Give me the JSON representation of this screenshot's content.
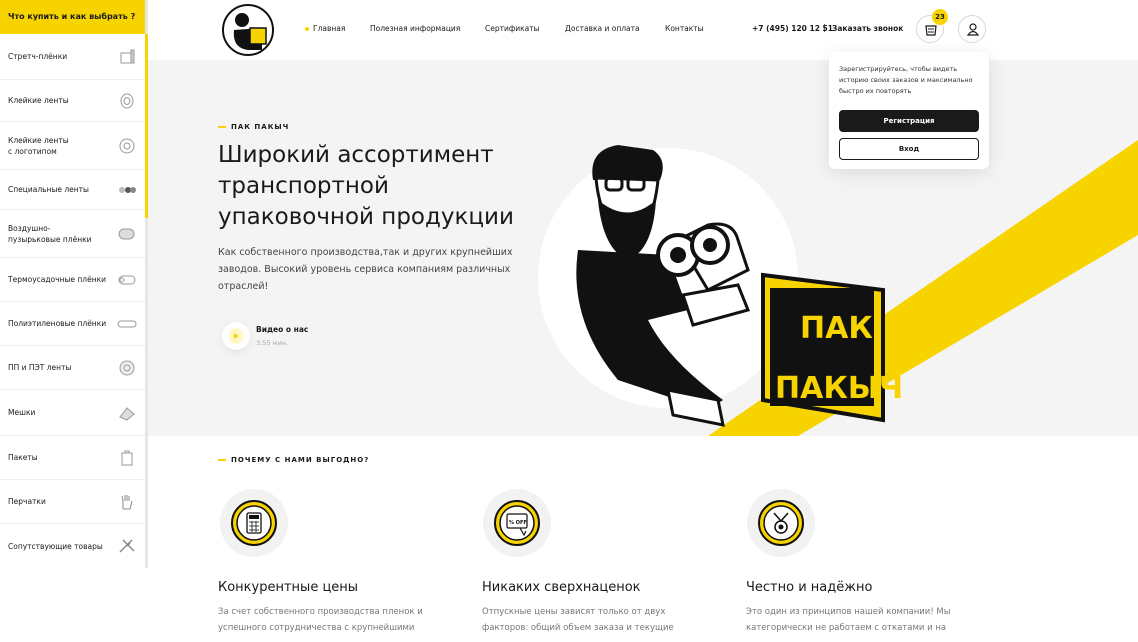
{
  "sidebar": {
    "header": "Что купить и как выбрать ?",
    "items": [
      {
        "label": "Стретч-плёнки",
        "icon": "stretch-film-icon"
      },
      {
        "label": "Клейкие ленты",
        "icon": "tape-roll-icon"
      },
      {
        "label": "Клейкие ленты\nс логотипом",
        "icon": "logo-tape-icon"
      },
      {
        "label": "Специальные ленты",
        "icon": "special-tape-icon"
      },
      {
        "label": "Воздушно-\nпузырьковые плёнки",
        "icon": "bubble-wrap-icon"
      },
      {
        "label": "Термоусадочные плёнки",
        "icon": "shrink-film-icon"
      },
      {
        "label": "Полиэтиленовые плёнки",
        "icon": "polyethylene-film-icon"
      },
      {
        "label": "ПП и ПЭТ ленты",
        "icon": "strapping-tape-icon"
      },
      {
        "label": "Мешки",
        "icon": "sack-icon"
      },
      {
        "label": "Пакеты",
        "icon": "bag-icon"
      },
      {
        "label": "Перчатки",
        "icon": "glove-icon"
      },
      {
        "label": "Сопутствующие товары",
        "icon": "tools-icon"
      }
    ]
  },
  "nav": {
    "items": [
      "Главная",
      "Полезная информация",
      "Сертификаты",
      "Доставка и оплата",
      "Контакты"
    ],
    "phone": "+7 (495) 120 12 51",
    "separator": "|",
    "callback": "Заказать звонок",
    "cart_count": "23"
  },
  "popover": {
    "text": "Зарегистрируйтесь, чтобы видеть историю своих заказов и максимально быстро их повторять",
    "register": "Регистрация",
    "login": "Вход"
  },
  "hero": {
    "eyebrow": "ПАК ПАКЫЧ",
    "title": "Широкий ассортимент транспортной упаковочной продукции",
    "text": "Как собственного производства,так и других крупнейших заводов. Высокий уровень сервиса компаниям различных отраслей!",
    "video_title": "Видео о нас",
    "video_time": "3:55 мин.",
    "box_line1": "ПАК",
    "box_line2": "ПАКЫЧ"
  },
  "why": {
    "eyebrow": "ПОЧЕМУ С НАМИ ВЫГОДНО?",
    "features": [
      {
        "title": "Конкурентные цены",
        "text": "За счет собственного производства пленок и успешного сотрудничества с крупнейшими",
        "icon": "calculator-icon"
      },
      {
        "title": "Никаких сверхнаценок",
        "text": "Отпускные цены зависят только от двух факторов: общий объем заказа и текущие",
        "icon": "discount-tag-icon"
      },
      {
        "title": "Честно и надёжно",
        "text": "Это один из принципов нашей компании! Мы категорически не работаем с откатами и на",
        "icon": "medal-icon"
      }
    ],
    "discount_tag": "% OFF"
  },
  "colors": {
    "accent": "#f7d300",
    "dark": "#1a1a1a",
    "bg": "#f4f4f4"
  }
}
